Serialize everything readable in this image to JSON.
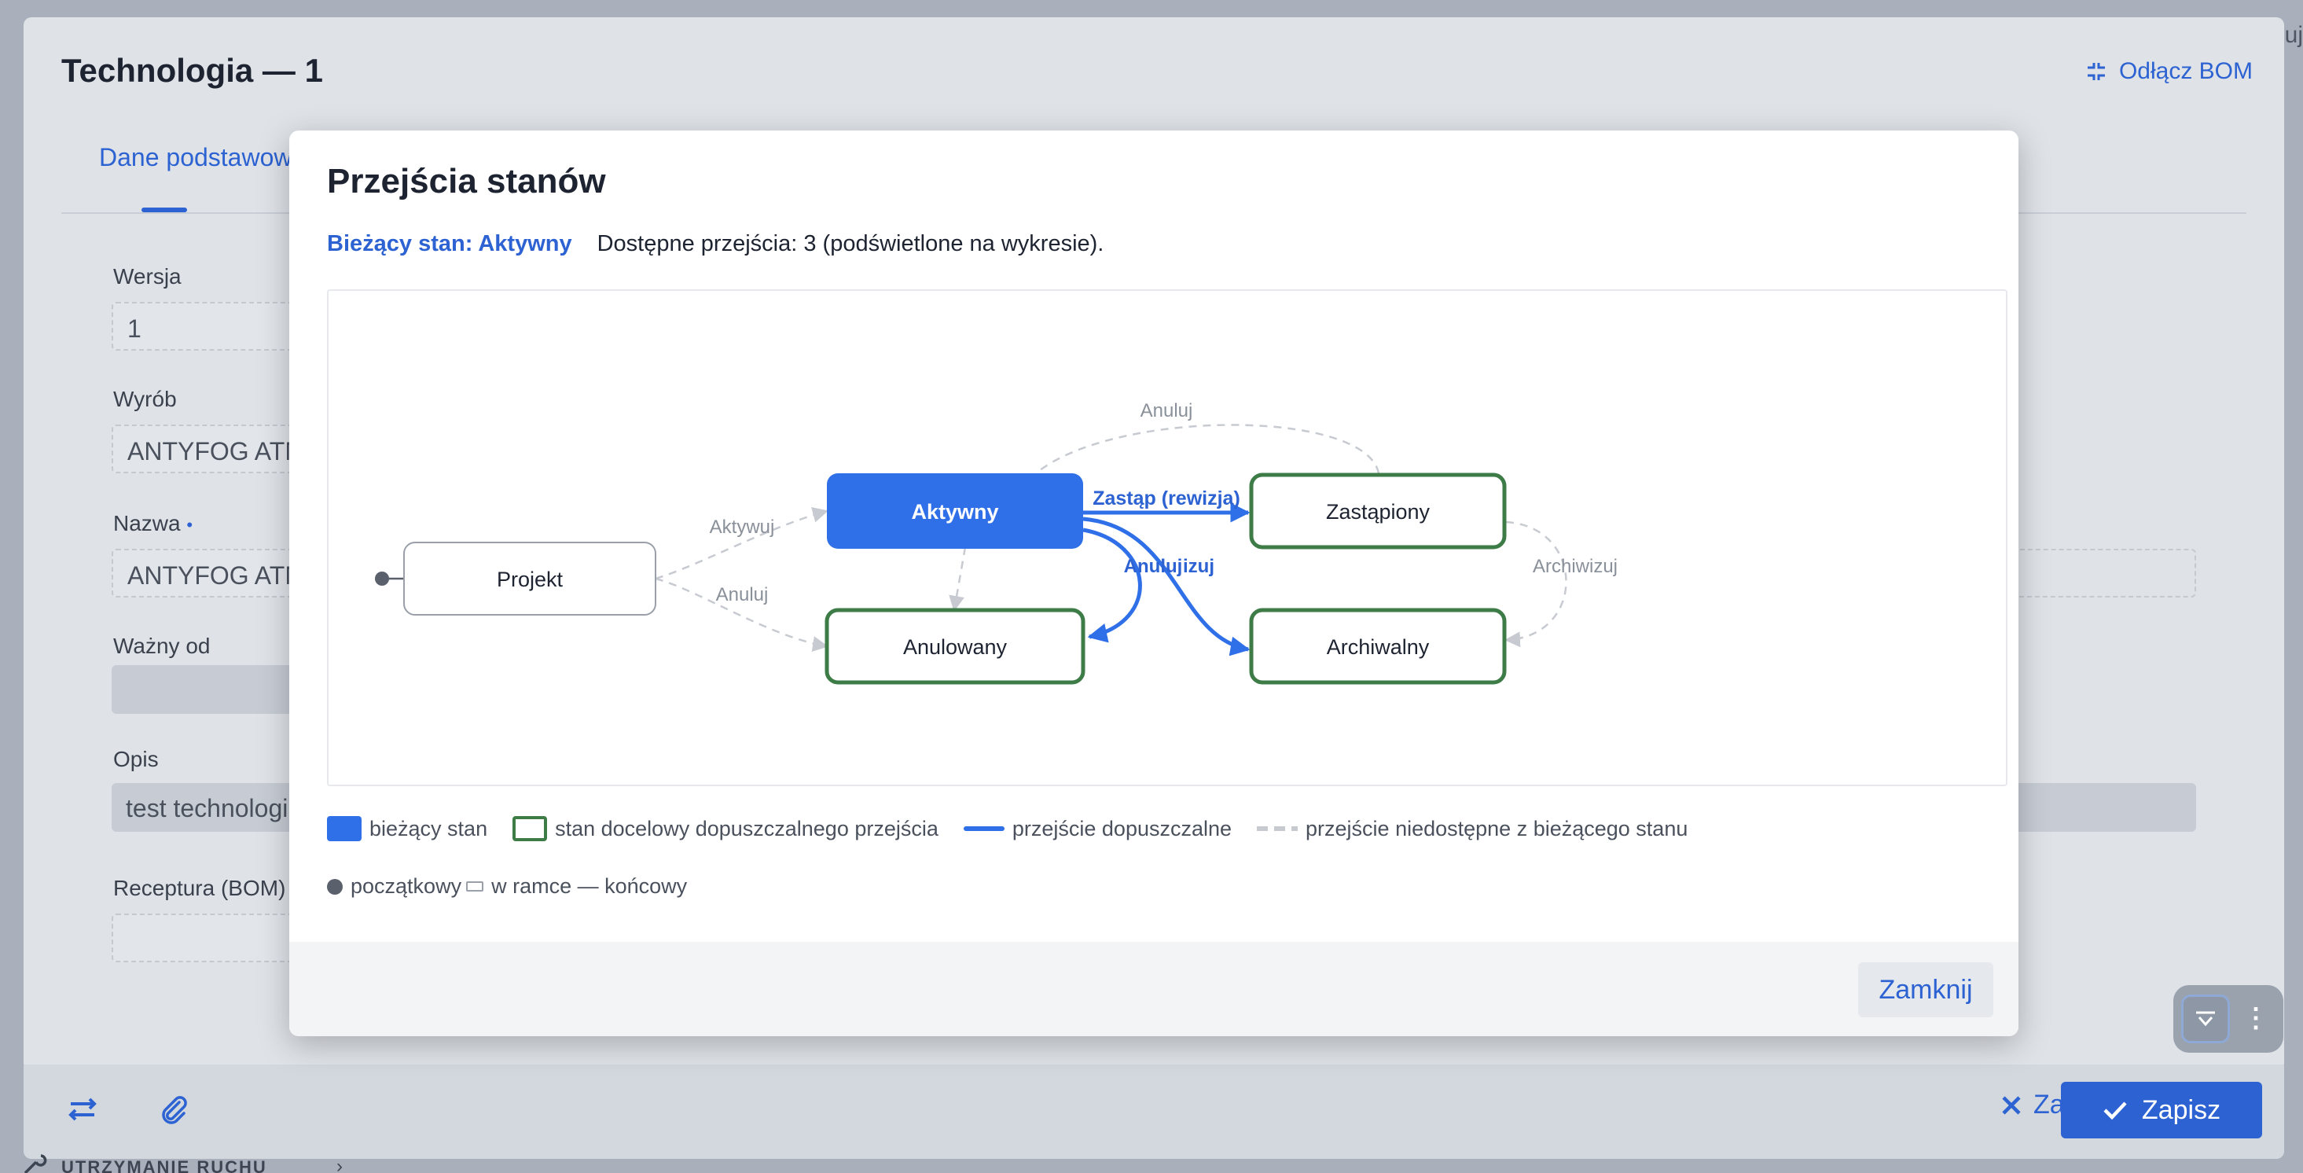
{
  "app": {
    "corner_text": "uj",
    "bottom_nav_label": "UTRZYMANIE RUCHU"
  },
  "window": {
    "title": "Technologia — 1",
    "detach_bom_label": "Odłącz BOM",
    "tab_active": "Dane podstawowe",
    "fields": {
      "version_label": "Wersja",
      "version_value": "1",
      "product_label": "Wyrób",
      "product_value": "ANTYFOG ATM",
      "name_label": "Nazwa",
      "name_required_marker": "•",
      "name_value": "ANTYFOG ATM",
      "valid_from_label": "Ważny od",
      "description_label": "Opis",
      "description_value": "test technologii",
      "recipe_label": "Receptura (BOM)"
    },
    "footer": {
      "close_label": "Zamknij",
      "save_label": "Zapisz"
    }
  },
  "modal": {
    "title": "Przejścia stanów",
    "current_state_text": "Bieżący stan: Aktywny",
    "available_text": "Dostępne przejścia: 3 (podświetlone na wykresie).",
    "nodes": {
      "projekt": "Projekt",
      "aktywny": "Aktywny",
      "zastapiony": "Zastąpiony",
      "anulowany": "Anulowany",
      "archiwalny": "Archiwalny"
    },
    "edges": {
      "aktywuj": "Aktywuj",
      "anuluj_projekt": "Anuluj",
      "anuluj_top": "Anuluj",
      "zastap": "Zastąp (rewizja)",
      "anuluj_active": "Anuluj",
      "archiwizuj_active": "izuj",
      "archiwizuj": "Archiwizuj"
    },
    "legend": {
      "current": "bieżący stan",
      "target": "stan docelowy dopuszczalnego przejścia",
      "allowed": "przejście dopuszczalne",
      "unavailable": "przejście niedostępne z bieżącego stanu",
      "initial": "początkowy",
      "final": "w ramce — końcowy"
    },
    "close_label": "Zamknij"
  },
  "colors": {
    "accent": "#2c62d1",
    "current_fill": "#2f6fe8",
    "target_border": "#3d7c47",
    "unavailable": "#c7cbd1"
  }
}
